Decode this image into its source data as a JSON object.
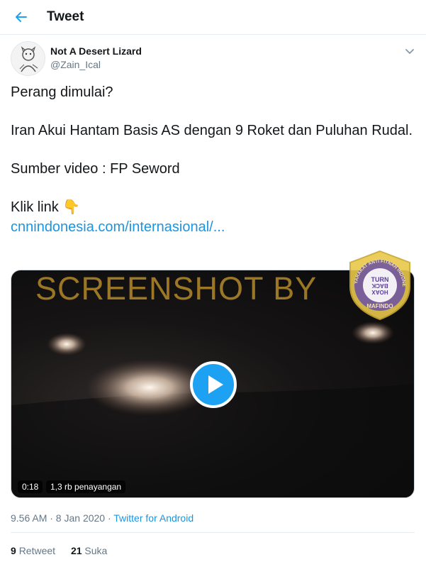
{
  "header": {
    "title": "Tweet",
    "back_icon": "arrow-left-icon"
  },
  "author": {
    "name": "Not A Desert Lizard",
    "handle": "@Zain_Ical"
  },
  "tweet": {
    "line1": "Perang dimulai?",
    "line2": "Iran Akui Hantam Basis AS dengan 9 Roket dan Puluhan Rudal.",
    "line3": "Sumber video : FP Seword",
    "line4_text": "Klik link",
    "line4_emoji": "👇",
    "link": "cnnindonesia.com/internasional/..."
  },
  "media": {
    "watermark": "SCREENSHOT BY",
    "duration": "0:18",
    "views": "1,3 rb penayangan",
    "badge": {
      "arc_top": "MASYARAKAT ANTI FITNAH INDONESIA",
      "center_1": "TURN",
      "center_2": "BACK",
      "center_3": "HOAX",
      "bottom": "MAFINDO"
    }
  },
  "meta": {
    "time": "9.56 AM · 8 Jan 2020 · ",
    "source": "Twitter for Android"
  },
  "stats": {
    "retweets_count": "9",
    "retweets_label": "Retweet",
    "likes_count": "21",
    "likes_label": "Suka"
  },
  "colors": {
    "accent": "#1b95e0",
    "text": "#14171a",
    "muted": "#657786",
    "border": "#e6ecf0",
    "badge_gold": "#e8c84a",
    "badge_purple": "#5b3f9a"
  }
}
